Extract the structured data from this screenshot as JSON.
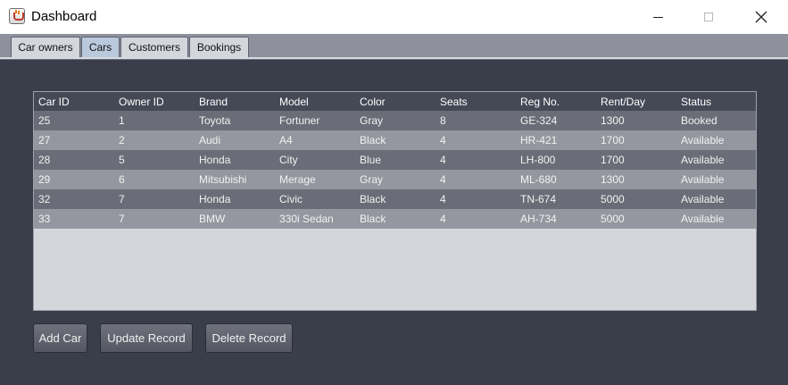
{
  "window": {
    "title": "Dashboard"
  },
  "tabs": [
    {
      "label": "Car owners",
      "active": false
    },
    {
      "label": "Cars",
      "active": true
    },
    {
      "label": "Customers",
      "active": false
    },
    {
      "label": "Bookings",
      "active": false
    }
  ],
  "table": {
    "columns": [
      "Car ID",
      "Owner ID",
      "Brand",
      "Model",
      "Color",
      "Seats",
      "Reg No.",
      "Rent/Day",
      "Status"
    ],
    "rows": [
      [
        "25",
        "1",
        "Toyota",
        "Fortuner",
        "Gray",
        "8",
        "GE-324",
        "1300",
        "Booked"
      ],
      [
        "27",
        "2",
        "Audi",
        "A4",
        "Black",
        "4",
        "HR-421",
        "1700",
        "Available"
      ],
      [
        "28",
        "5",
        "Honda",
        "City",
        "Blue",
        "4",
        "LH-800",
        "1700",
        "Available"
      ],
      [
        "29",
        "6",
        "Mitsubishi",
        "Merage",
        "Gray",
        "4",
        "ML-680",
        "1300",
        "Available"
      ],
      [
        "32",
        "7",
        "Honda",
        "Civic",
        "Black",
        "4",
        "TN-674",
        "5000",
        "Available"
      ],
      [
        "33",
        "7",
        "BMW",
        "330i Sedan",
        "Black",
        "4",
        "AH-734",
        "5000",
        "Available"
      ]
    ]
  },
  "buttons": {
    "add": "Add Car",
    "update": "Update Record",
    "delete": "Delete Record"
  },
  "colors": {
    "background": "#3a3e4b",
    "header": "#454956",
    "row_dark": "#6a6d77",
    "row_light": "#94979f",
    "empty_area": "#d4d6dc"
  },
  "icons": {
    "app": "java-coffee-cup-icon",
    "minimize": "minimize-icon",
    "maximize": "maximize-icon",
    "close": "close-icon"
  }
}
